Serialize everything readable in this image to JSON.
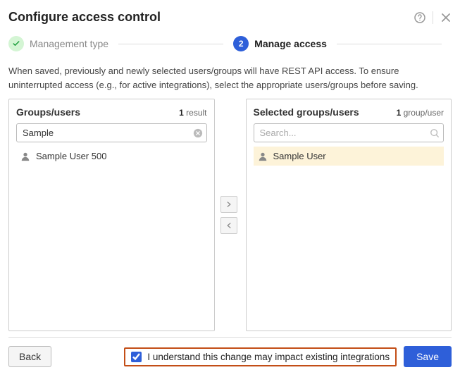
{
  "header": {
    "title": "Configure access control"
  },
  "stepper": {
    "step1_label": "Management type",
    "step2_number": "2",
    "step2_label": "Manage access"
  },
  "description": "When saved, previously and newly selected users/groups will have REST API access. To ensure uninterrupted access (e.g., for active integrations), select the appropriate users/groups before saving.",
  "left": {
    "title": "Groups/users",
    "count_strong": "1",
    "count_label": " result",
    "search_value": "Sample",
    "items": [
      {
        "label": "Sample User 500"
      }
    ]
  },
  "right": {
    "title": "Selected groups/users",
    "count_strong": "1",
    "count_label": " group/user",
    "search_placeholder": "Search...",
    "items": [
      {
        "label": "Sample User"
      }
    ]
  },
  "footer": {
    "back_label": "Back",
    "confirm_label": "I understand this change may impact existing integrations",
    "save_label": "Save"
  }
}
